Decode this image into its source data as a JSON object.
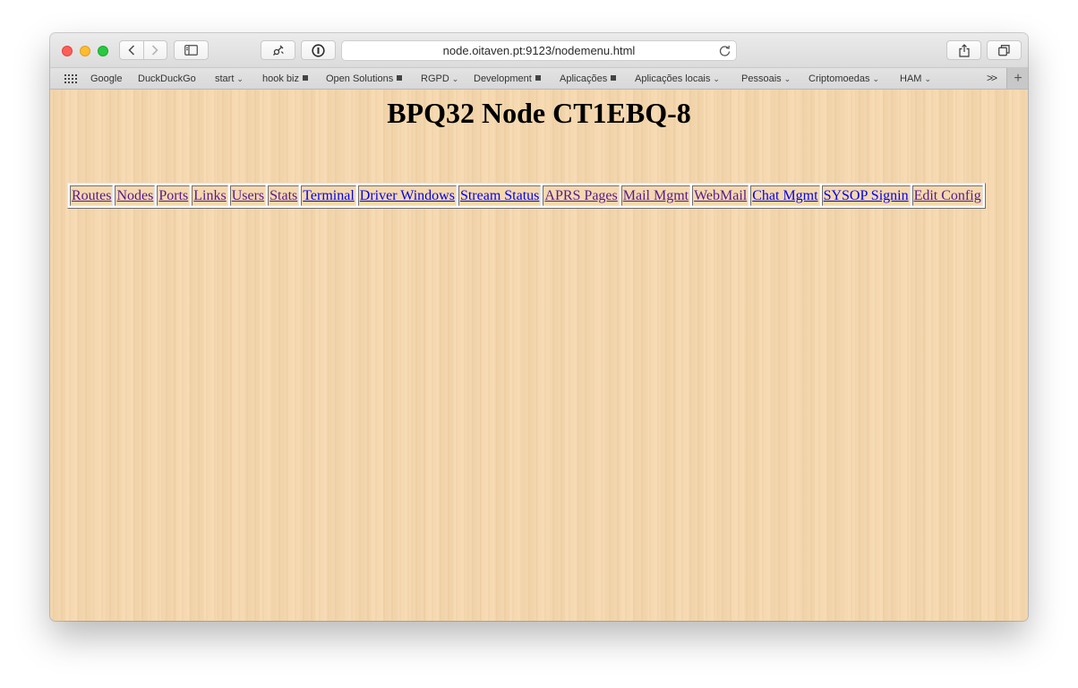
{
  "browser": {
    "url": "node.oitaven.pt:9123/nodemenu.html",
    "bookmarks": [
      {
        "label": "Google",
        "marker": "none"
      },
      {
        "label": "DuckDuckGo",
        "marker": "none"
      },
      {
        "label": "start",
        "marker": "chevron"
      },
      {
        "label": "hook biz",
        "marker": "square"
      },
      {
        "label": "Open Solutions",
        "marker": "square"
      },
      {
        "label": "RGPD",
        "marker": "chevron"
      },
      {
        "label": "Development",
        "marker": "square"
      },
      {
        "label": "Aplicações",
        "marker": "square"
      },
      {
        "label": "Aplicações locais",
        "marker": "chevron"
      },
      {
        "label": "Pessoais",
        "marker": "chevron"
      },
      {
        "label": "Criptomoedas",
        "marker": "chevron"
      },
      {
        "label": "HAM",
        "marker": "chevron"
      }
    ],
    "more_label": ">>",
    "new_tab_label": "+"
  },
  "page": {
    "title": "BPQ32 Node CT1EBQ-8",
    "menu": [
      {
        "label": "Routes",
        "visited": true
      },
      {
        "label": "Nodes",
        "visited": true
      },
      {
        "label": "Ports",
        "visited": true
      },
      {
        "label": "Links",
        "visited": true
      },
      {
        "label": "Users",
        "visited": true
      },
      {
        "label": "Stats",
        "visited": true
      },
      {
        "label": "Terminal",
        "visited": false
      },
      {
        "label": "Driver Windows",
        "visited": false
      },
      {
        "label": "Stream Status",
        "visited": false
      },
      {
        "label": "APRS Pages",
        "visited": true
      },
      {
        "label": "Mail Mgmt",
        "visited": true
      },
      {
        "label": "WebMail",
        "visited": true
      },
      {
        "label": "Chat Mgmt",
        "visited": false
      },
      {
        "label": "SYSOP Signin",
        "visited": false
      },
      {
        "label": "Edit Config",
        "visited": true
      }
    ]
  },
  "colors": {
    "page_background": "#f5d8ae",
    "link_unvisited": "#0000ee",
    "link_visited": "#551a8b"
  }
}
